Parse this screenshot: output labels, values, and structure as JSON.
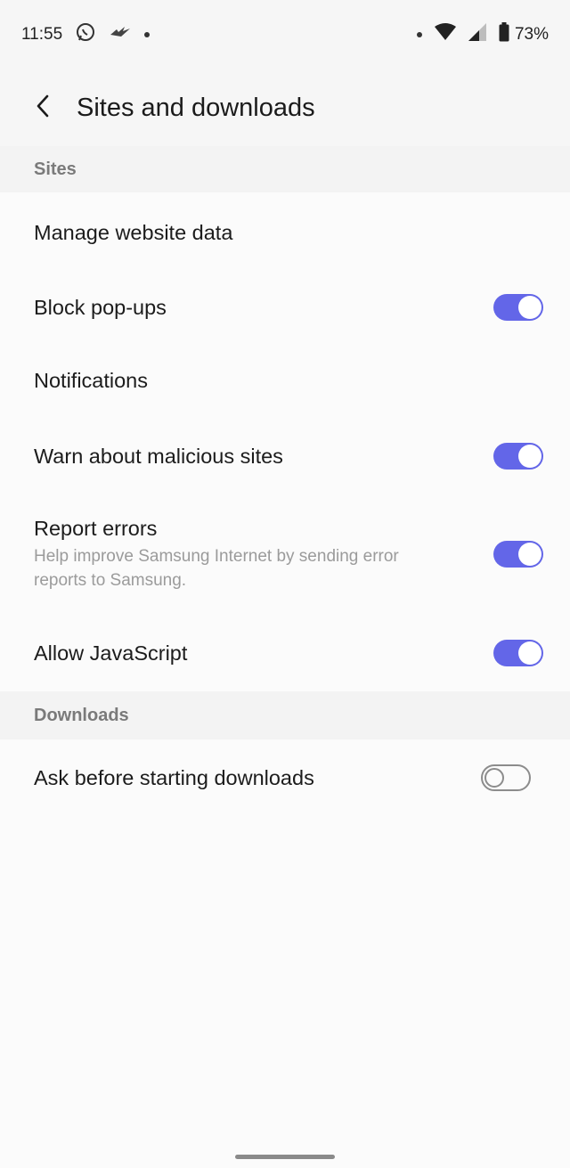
{
  "status_bar": {
    "time": "11:55",
    "battery_percent": "73%",
    "left_icons": [
      "whatsapp-icon",
      "bird-icon",
      "dot"
    ],
    "right_icons": [
      "dot",
      "wifi-icon",
      "signal-icon",
      "battery-icon"
    ]
  },
  "header": {
    "title": "Sites and downloads",
    "back_icon": "chevron-left-icon"
  },
  "sections": {
    "sites": {
      "label": "Sites",
      "items": {
        "manage_website_data": {
          "title": "Manage website data"
        },
        "block_popups": {
          "title": "Block pop-ups",
          "toggle": "on"
        },
        "notifications": {
          "title": "Notifications"
        },
        "warn_malicious": {
          "title": "Warn about malicious sites",
          "toggle": "on"
        },
        "report_errors": {
          "title": "Report errors",
          "subtitle": "Help improve Samsung Internet by sending error reports to Samsung.",
          "toggle": "on"
        },
        "allow_javascript": {
          "title": "Allow JavaScript",
          "toggle": "on"
        }
      }
    },
    "downloads": {
      "label": "Downloads",
      "items": {
        "ask_before_downloads": {
          "title": "Ask before starting downloads",
          "toggle": "off"
        }
      }
    }
  },
  "colors": {
    "accent": "#6366e8",
    "background": "#fbfbfb",
    "section_bg": "#f3f3f3",
    "section_text": "#7a7a7a",
    "subtitle_text": "#9b9b9b"
  }
}
